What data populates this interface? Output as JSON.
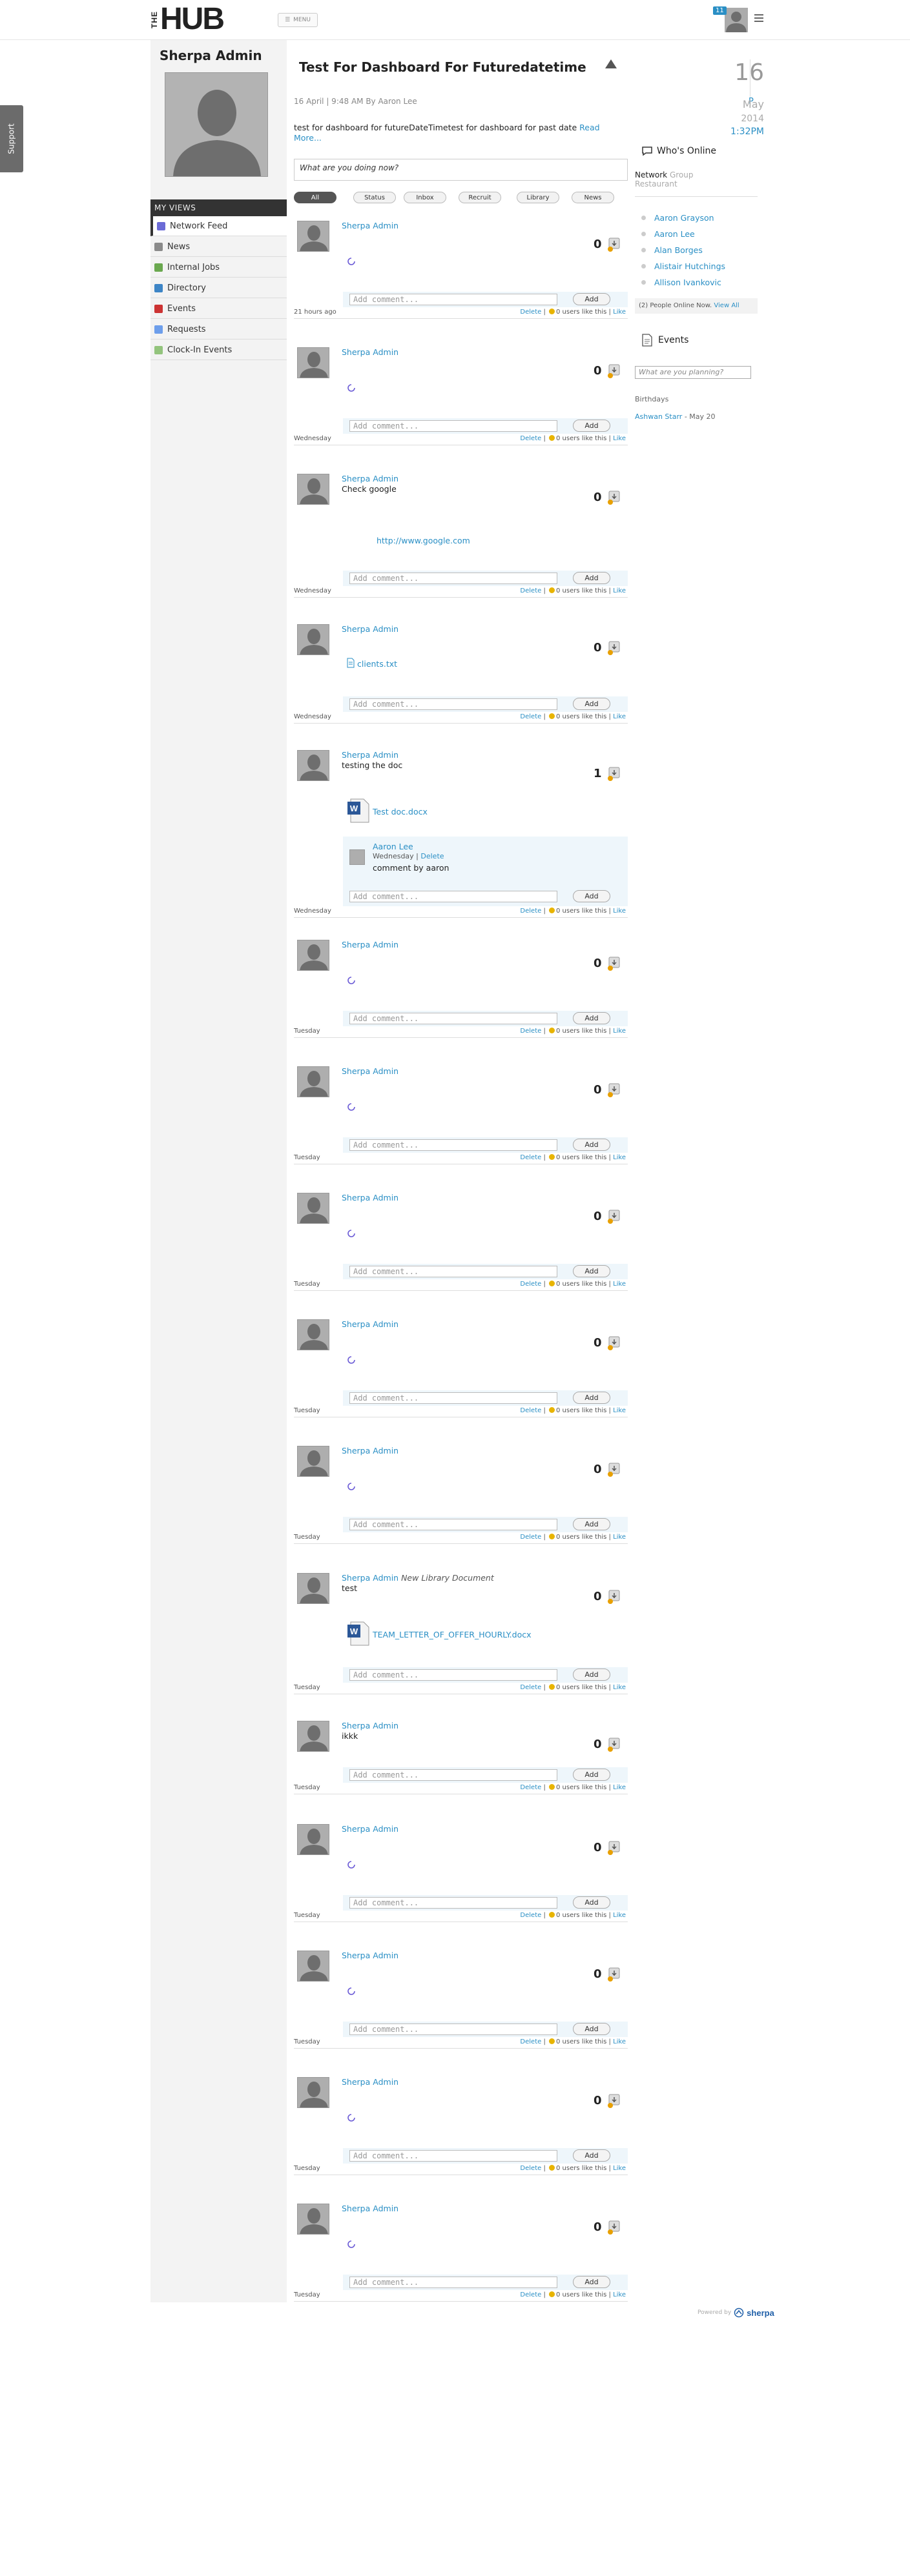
{
  "header": {
    "logo_the": "THE",
    "logo_hub": "HUB",
    "menu_label": "MENU",
    "notification_count": "11"
  },
  "support_label": "Support",
  "profile": {
    "name": "Sherpa Admin"
  },
  "nav": {
    "header": "MY VIEWS",
    "items": [
      {
        "label": "Network Feed",
        "icon": "feed-icon",
        "color": "#6b6bd6"
      },
      {
        "label": "News",
        "icon": "news-icon",
        "color": "#8a8a8a"
      },
      {
        "label": "Internal Jobs",
        "icon": "jobs-icon",
        "color": "#6aa84f"
      },
      {
        "label": "Directory",
        "icon": "directory-icon",
        "color": "#3d85c6"
      },
      {
        "label": "Events",
        "icon": "calendar-icon",
        "color": "#cc3333"
      },
      {
        "label": "Requests",
        "icon": "requests-icon",
        "color": "#6d9eeb"
      },
      {
        "label": "Clock-In Events",
        "icon": "clock-icon",
        "color": "#93c47d"
      }
    ]
  },
  "banner": {
    "title": "Test For Dashboard For Futuredatetime",
    "meta": "16 April | 9:48 AM By Aaron Lee",
    "body": "test for dashboard for futureDateTimetest for dashboard for past date",
    "read_more": "Read More..."
  },
  "status_placeholder": "What are you doing now?",
  "filters": [
    "All",
    "Status",
    "Inbox",
    "Recruit",
    "Library",
    "News"
  ],
  "feed": {
    "comment_placeholder": "Add comment...",
    "add_label": "Add",
    "delete_label": "Delete",
    "likes_suffix": "0 users like this",
    "like_label": "Like",
    "posts": [
      {
        "author": "Sherpa Admin",
        "context": "",
        "text": "",
        "score": "0",
        "time": "21 hours ago",
        "kind": "spinner"
      },
      {
        "author": "Sherpa Admin",
        "context": "",
        "text": "",
        "score": "0",
        "time": "Wednesday",
        "kind": "spinner"
      },
      {
        "author": "Sherpa Admin",
        "context": "",
        "text": "Check google",
        "score": "0",
        "time": "Wednesday",
        "kind": "link",
        "link": "http://www.google.com"
      },
      {
        "author": "Sherpa Admin",
        "context": "",
        "text": "",
        "score": "0",
        "time": "Wednesday",
        "kind": "file",
        "file": "clients.txt"
      },
      {
        "author": "Sherpa Admin",
        "context": "",
        "text": "testing the doc",
        "score": "1",
        "time": "Wednesday",
        "kind": "doc",
        "file": "Test doc.docx",
        "comment": {
          "name": "Aaron Lee",
          "when": "Wednesday",
          "delete": "Delete",
          "text": "comment by aaron"
        }
      },
      {
        "author": "Sherpa Admin",
        "context": "",
        "text": "",
        "score": "0",
        "time": "Tuesday",
        "kind": "spinner"
      },
      {
        "author": "Sherpa Admin",
        "context": "",
        "text": "",
        "score": "0",
        "time": "Tuesday",
        "kind": "spinner"
      },
      {
        "author": "Sherpa Admin",
        "context": "",
        "text": "",
        "score": "0",
        "time": "Tuesday",
        "kind": "spinner"
      },
      {
        "author": "Sherpa Admin",
        "context": "",
        "text": "",
        "score": "0",
        "time": "Tuesday",
        "kind": "spinner"
      },
      {
        "author": "Sherpa Admin",
        "context": "",
        "text": "",
        "score": "0",
        "time": "Tuesday",
        "kind": "spinner"
      },
      {
        "author": "Sherpa Admin",
        "context": "New Library Document",
        "text": "test",
        "score": "0",
        "time": "Tuesday",
        "kind": "doc",
        "file": "TEAM_LETTER_OF_OFFER_HOURLY.docx"
      },
      {
        "author": "Sherpa Admin",
        "context": "",
        "text": "ikkk",
        "score": "0",
        "time": "Tuesday",
        "kind": "plain"
      },
      {
        "author": "Sherpa Admin",
        "context": "",
        "text": "",
        "score": "0",
        "time": "Tuesday",
        "kind": "spinner"
      },
      {
        "author": "Sherpa Admin",
        "context": "",
        "text": "",
        "score": "0",
        "time": "Tuesday",
        "kind": "spinner"
      },
      {
        "author": "Sherpa Admin",
        "context": "",
        "text": "",
        "score": "0",
        "time": "Tuesday",
        "kind": "spinner"
      },
      {
        "author": "Sherpa Admin",
        "context": "",
        "text": "",
        "score": "0",
        "time": "Tuesday",
        "kind": "spinner"
      }
    ]
  },
  "date": {
    "day": "16",
    "month": "May",
    "year": "2014",
    "time": "1:32PM",
    "marker": "P"
  },
  "whos_online": {
    "title": "Who's Online",
    "tab_network": "Network",
    "tab_group": "Group",
    "tab_restaurant": "Restaurant",
    "users": [
      "Aaron Grayson",
      "Aaron Lee",
      "Alan Borges",
      "Alistair Hutchings",
      "Allison Ivankovic"
    ],
    "people_online_text": "(2) People Online Now.",
    "view_all": "View All"
  },
  "events": {
    "title": "Events",
    "placeholder": "What are you planning?",
    "birthdays_label": "Birthdays",
    "birthday_name": "Ashwan Starr",
    "birthday_date": " - May 20"
  },
  "powered": {
    "label": "Powered by",
    "brand": "sherpa"
  },
  "colors": {
    "accent": "#2a8fc5",
    "sidebar_bg": "#f3f3f3",
    "comment_bg": "#eef6fb"
  }
}
